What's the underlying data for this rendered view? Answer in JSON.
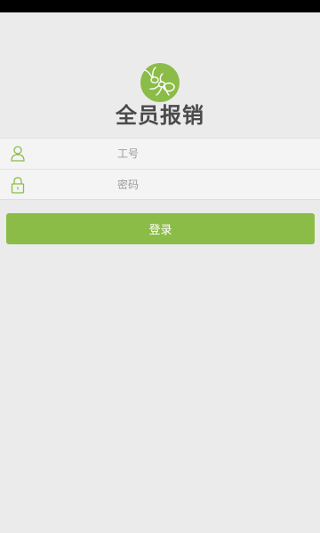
{
  "app": {
    "title": "全员报销",
    "logo_icon": "ant-logo-icon"
  },
  "form": {
    "employee_id": {
      "icon": "user-icon",
      "placeholder": "工号",
      "value": ""
    },
    "password": {
      "icon": "lock-icon",
      "placeholder": "密码",
      "value": ""
    }
  },
  "actions": {
    "login_label": "登录"
  },
  "colors": {
    "accent": "#8bbc48",
    "background": "#ebebeb",
    "status_bar": "#000000",
    "title_text": "#4a4a4a"
  }
}
